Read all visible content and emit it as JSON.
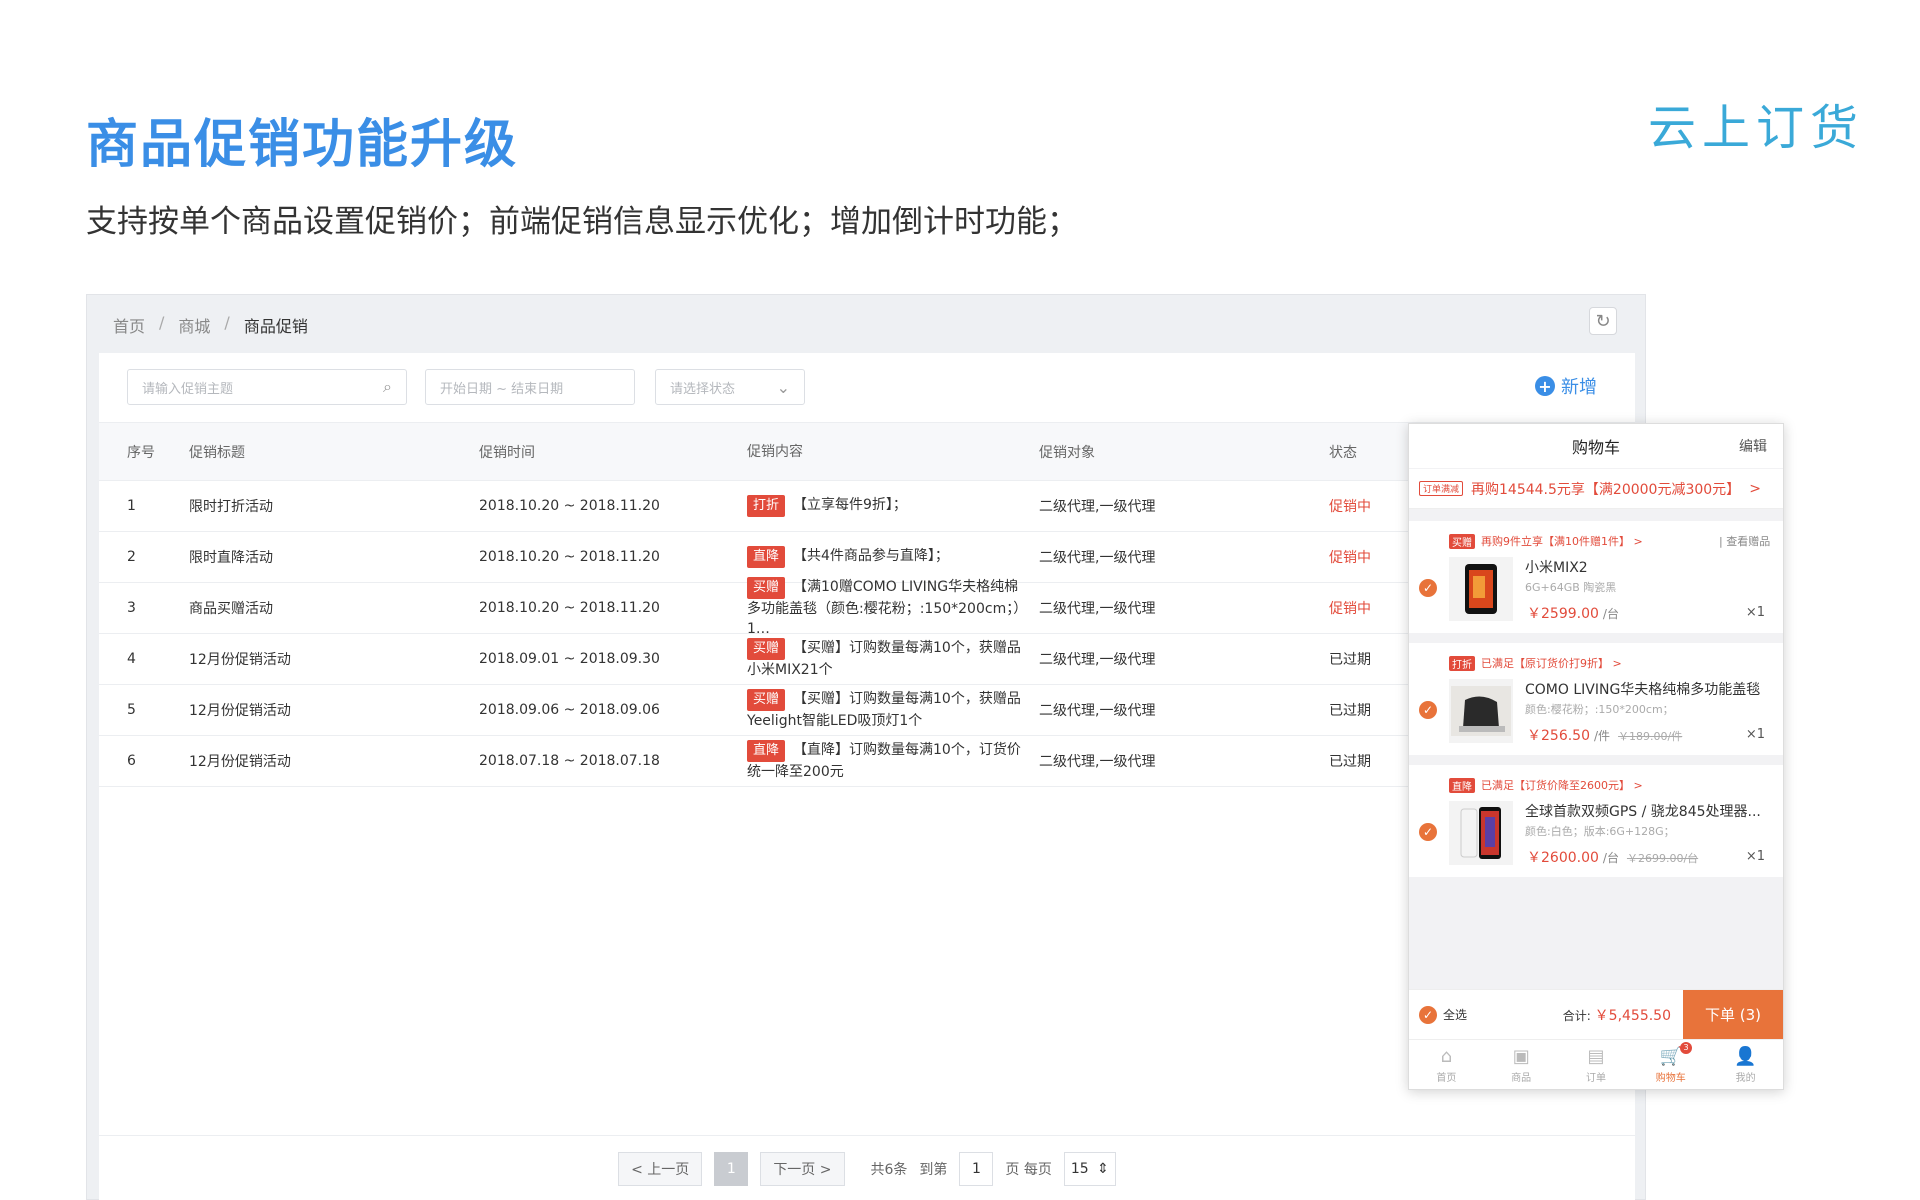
{
  "slide": {
    "title": "商品促销功能升级",
    "subtitle": "支持按单个商品设置促销价；前端促销信息显示优化；增加倒计时功能；",
    "logo_text": "云上订货"
  },
  "breadcrumb": [
    "首页",
    "商城",
    "商品促销"
  ],
  "breadcrumb_sep": "/",
  "filters": {
    "search_placeholder": "请输入促销主题",
    "date_placeholder": "开始日期 ~ 结束日期",
    "status_placeholder": "请选择状态",
    "add_label": "新增"
  },
  "table": {
    "headers": [
      "序号",
      "促销标题",
      "促销时间",
      "促销内容",
      "促销对象",
      "状态"
    ],
    "rows": [
      {
        "no": "1",
        "title": "限时打折活动",
        "time": "2018.10.20 ~ 2018.11.20",
        "tag": "打折",
        "content": "【立享每件9折】；",
        "target": "二级代理,一级代理",
        "status": "促销中",
        "active": true
      },
      {
        "no": "2",
        "title": "限时直降活动",
        "time": "2018.10.20 ~ 2018.11.20",
        "tag": "直降",
        "content": "【共4件商品参与直降】；",
        "target": "二级代理,一级代理",
        "status": "促销中",
        "active": true
      },
      {
        "no": "3",
        "title": "商品买赠活动",
        "time": "2018.10.20 ~ 2018.11.20",
        "tag": "买赠",
        "content": "【满10赠COMO LIVING华夫格纯棉多功能盖毯（颜色:樱花粉；:150*200cm；）1…",
        "target": "二级代理,一级代理",
        "status": "促销中",
        "active": true
      },
      {
        "no": "4",
        "title": "12月份促销活动",
        "time": "2018.09.01 ~ 2018.09.30",
        "tag": "买赠",
        "content": "【买赠】订购数量每满10个，获赠品小米MIX21个",
        "target": "二级代理,一级代理",
        "status": "已过期",
        "active": false
      },
      {
        "no": "5",
        "title": "12月份促销活动",
        "time": "2018.09.06 ~ 2018.09.06",
        "tag": "买赠",
        "content": "【买赠】订购数量每满10个，获赠品Yeelight智能LED吸顶灯1个",
        "target": "二级代理,一级代理",
        "status": "已过期",
        "active": false
      },
      {
        "no": "6",
        "title": "12月份促销活动",
        "time": "2018.07.18 ~ 2018.07.18",
        "tag": "直降",
        "content": "【直降】订购数量每满10个，订货价统一降至200元",
        "target": "二级代理,一级代理",
        "status": "已过期",
        "active": false
      }
    ]
  },
  "pagination": {
    "prev": "< 上一页",
    "current": "1",
    "next": "下一页 >",
    "total": "共6条",
    "goto_prefix": "到第",
    "goto_value": "1",
    "goto_suffix": "页 每页",
    "page_size": "15"
  },
  "cart": {
    "title": "购物车",
    "edit": "编辑",
    "order_promo_chip": "订单满减",
    "order_promo_text": "再购14544.5元享【满20000元减300元】",
    "order_promo_arrow": ">",
    "groups": [
      {
        "tag": "买赠",
        "header": "再购9件立享【满10件赠1件】 >",
        "extra": "| 查看赠品",
        "name": "小米MIX2",
        "spec": "6G+64GB 陶瓷黑",
        "price": "￥2599.00",
        "unit": "/台",
        "old_price": "",
        "qty": "×1"
      },
      {
        "tag": "打折",
        "header": "已满足【原订货价打9折】 >",
        "extra": "",
        "name": "COMO LIVING华夫格纯棉多功能盖毯",
        "spec": "颜色:樱花粉；:150*200cm；",
        "price": "￥256.50",
        "unit": "/件",
        "old_price": "￥189.00/件",
        "qty": "×1"
      },
      {
        "tag": "直降",
        "header": "已满足【订货价降至2600元】 >",
        "extra": "",
        "name": "全球首款双频GPS / 骁龙845处理器...",
        "spec": "颜色:白色；版本:6G+128G；",
        "price": "￥2600.00",
        "unit": "/台",
        "old_price": "￥2699.00/台",
        "qty": "×1"
      }
    ],
    "select_all": "全选",
    "total_label": "合计:",
    "total_value": "￥5,455.50",
    "submit": "下单 (3)",
    "tabs": [
      {
        "label": "首页",
        "icon": "home-icon"
      },
      {
        "label": "商品",
        "icon": "goods-icon"
      },
      {
        "label": "订单",
        "icon": "order-icon"
      },
      {
        "label": "购物车",
        "icon": "cart-icon",
        "badge": "3"
      },
      {
        "label": "我的",
        "icon": "user-icon"
      }
    ]
  },
  "colors": {
    "title_blue": "#3a8ee6",
    "promo_red": "#e24b3b",
    "cart_orange": "#e8733a"
  }
}
